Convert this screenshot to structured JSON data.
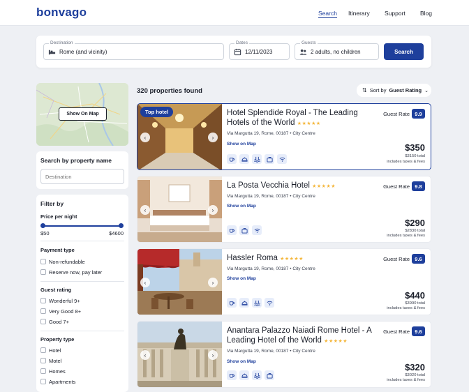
{
  "brand": {
    "logo": "bonvago",
    "accent": "#1e3f9c"
  },
  "nav": [
    {
      "label": "Search",
      "active": true
    },
    {
      "label": "Itinerary"
    },
    {
      "label": "Support"
    },
    {
      "label": "Blog"
    }
  ],
  "search": {
    "destination_label": "Destination",
    "destination_value": "Rome (and vicinity)",
    "dates_label": "Dates",
    "dates_value": "12/11/2023",
    "guests_label": "Guests",
    "guests_value": "2 adults, no children",
    "button": "Search"
  },
  "map": {
    "button": "Show On Map"
  },
  "name_search": {
    "title": "Search by property name",
    "placeholder": "Destination"
  },
  "filters": {
    "title": "Filter by",
    "price": {
      "title": "Price per night",
      "min_label": "$50",
      "max_label": "$4600"
    },
    "payment": {
      "title": "Payment type",
      "options": [
        "Non-refundable",
        "Reserve now, pay later"
      ]
    },
    "rating": {
      "title": "Guest rating",
      "options": [
        "Wonderful 9+",
        "Very Good 8+",
        "Good 7+"
      ]
    },
    "property": {
      "title": "Property type",
      "options": [
        "Hotel",
        "Motel",
        "Homes",
        "Apartments"
      ]
    }
  },
  "results": {
    "count": "320 properties found",
    "sort_prefix": "Sort by",
    "sort_value": "Guest Rating"
  },
  "hotels": [
    {
      "name": "Hotel Splendide Royal - The Leading Hotels of the World",
      "stars": "★★★★★",
      "badge": "Top hotel",
      "address": "Via Margutta 19, Rome, 00187",
      "area": "City Centre",
      "show_map": "Show on Map",
      "rate_label": "Guest Rate",
      "score": "9.9",
      "price": "$350",
      "total": "$3150 total",
      "taxes": "includes taxes & fees",
      "amenities": [
        "coffee-icon",
        "room-service-icon",
        "pool-icon",
        "bag-icon",
        "wifi-icon"
      ]
    },
    {
      "name": "La Posta Vecchia Hotel",
      "stars": "★★★★★",
      "address": "Via Margutta 19, Rome, 00187",
      "area": "City Centre",
      "show_map": "Show on Map",
      "rate_label": "Guest Rate",
      "score": "9.8",
      "price": "$290",
      "total": "$2830 total",
      "taxes": "includes taxes & fees",
      "amenities": [
        "coffee-icon",
        "bag-icon",
        "wifi-icon"
      ]
    },
    {
      "name": "Hassler Roma",
      "stars": "★★★★★",
      "address": "Via Margutta 19, Rome, 00187",
      "area": "City Centre",
      "show_map": "Show on Map",
      "rate_label": "Guest Rate",
      "score": "9.6",
      "price": "$440",
      "total": "$3990 total",
      "taxes": "includes taxes & fees",
      "amenities": [
        "coffee-icon",
        "room-service-icon",
        "pool-icon",
        "wifi-icon"
      ]
    },
    {
      "name": "Anantara Palazzo Naiadi Rome Hotel - A Leading Hotel of the World",
      "stars": "★★★★★",
      "address": "Via Margutta 19, Rome, 00187",
      "area": "City Centre",
      "show_map": "Show on Map",
      "rate_label": "Guest Rate",
      "score": "9.6",
      "price": "$320",
      "total": "$3020 total",
      "taxes": "includes taxes & fees",
      "amenities": [
        "coffee-icon",
        "room-service-icon",
        "pool-icon",
        "bag-icon"
      ]
    }
  ]
}
